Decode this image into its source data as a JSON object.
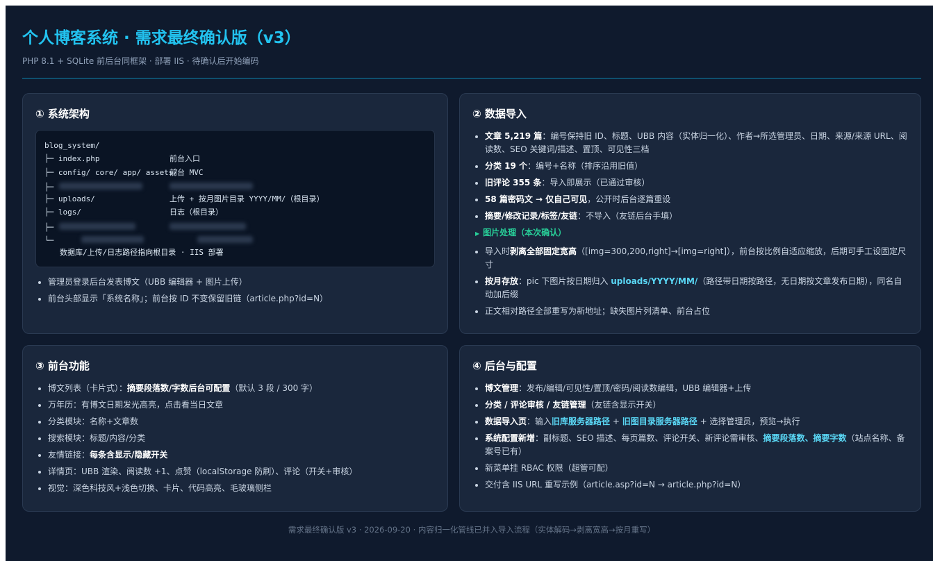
{
  "header": {
    "title": "个人博客系统 · 需求最终确认版（v3）",
    "subtitle": "PHP 8.1 + SQLite 前后台同框架 · 部署 IIS · 待确认后开始编码"
  },
  "cards": {
    "arch": {
      "title": "① 系统架构",
      "code": {
        "root": "blog_system/",
        "l1a": "├─ index.php",
        "l1b": "前台入口",
        "l2a": "├─ config/ core/ app/ assets/",
        "l2b": "前台 MVC",
        "l3a": "├─",
        "l4a": "├─ uploads/",
        "l4b": "上传 + 按月图片目录 YYYY/MM/（根目录）",
        "l5a": "├─ logs/",
        "l5b": "日志（根目录）",
        "l6a": "├─",
        "l7a": "└─",
        "note": "数据库/上传/日志路径指向根目录 · IIS 部署"
      },
      "bullets": [
        "管理员登录后台发表博文（UBB 编辑器 + 图片上传）",
        "前台头部显示「系统名称」；前台按 ID 不变保留旧链（article.php?id=N）"
      ]
    },
    "import": {
      "title": "② 数据导入",
      "b1": {
        "strong": "文章 5,219 篇",
        "text": "：编号保持旧 ID、标题、UBB 内容（实体归一化）、作者→所选管理员、日期、来源/来源 URL、阅读数、SEO 关键词/描述、置顶、可见性三档"
      },
      "b2": {
        "strong": "分类 19 个",
        "text": "：编号+名称（排序沿用旧值）"
      },
      "b3": {
        "strong": "旧评论 355 条",
        "text": "：导入即展示（已通过审核）"
      },
      "b4": {
        "strong": "58 篇密码文 → 仅自己可见",
        "text": "，公开时后台逐篇重设"
      },
      "b5": {
        "strong": "摘要/修改记录/标签/友链",
        "text": "：不导入（友链后台手填）"
      },
      "sub": "图片处理（本次确认）",
      "b6": {
        "pre": "导入时",
        "strong": "剥离全部固定宽高",
        "text": "（[img=300,200,right]→[img=right]），前台按比例自适应缩放，后期可手工设固定尺寸"
      },
      "b7": {
        "strong": "按月存放",
        "mid": "：pic 下图片按日期归入 ",
        "hl": "uploads/YYYY/MM/",
        "text": "（路径带日期按路径，无日期按文章发布日期），同名自动加后缀"
      },
      "b8": "正文相对路径全部重写为新地址；缺失图片列清单、前台占位"
    },
    "front": {
      "title": "③ 前台功能",
      "b1": {
        "pre": "博文列表（卡片式）：",
        "strong": "摘要段落数/字数后台可配置",
        "text": "（默认 3 段 / 300 字）"
      },
      "b2": "万年历：有博文日期发光高亮，点击看当日文章",
      "b3": "分类模块：名称+文章数",
      "b4": "搜索模块：标题/内容/分类",
      "b5": {
        "pre": "友情链接：",
        "strong": "每条含显示/隐藏开关"
      },
      "b6": "详情页：UBB 渲染、阅读数 +1、点赞（localStorage 防刷）、评论（开关+审核）",
      "b7": "视觉：深色科技风+浅色切换、卡片、代码高亮、毛玻璃侧栏"
    },
    "admin": {
      "title": "④ 后台与配置",
      "b1": {
        "strong": "博文管理",
        "text": "：发布/编辑/可见性/置顶/密码/阅读数编辑，UBB 编辑器+上传"
      },
      "b2": {
        "strong": "分类 / 评论审核 / 友链管理",
        "text": "（友链含显示开关）"
      },
      "b3": {
        "strong": "数据导入页",
        "pre": "：输入",
        "hl1": "旧库服务器路径",
        "mid": " + ",
        "hl2": "旧图目录服务器路径",
        "text": " + 选择管理员，预览→执行"
      },
      "b4": {
        "strong": "系统配置新增",
        "pre": "：副标题、SEO 描述、每页篇数、评论开关、新评论需审核、",
        "hl": "摘要段落数、摘要字数",
        "text": "（站点名称、备案号已有）"
      },
      "b5": "新菜单挂 RBAC 权限（超管可配）",
      "b6": "交付含 IIS URL 重写示例（article.asp?id=N → article.php?id=N）"
    }
  },
  "footer": "需求最终确认版 v3 · 2026-09-20 · 内容归一化管线已并入导入流程（实体解码→剥离宽高→按月重写）",
  "colors": {
    "accent": "#22c3f0",
    "green": "#28d19a",
    "bg": "#0f1a2d",
    "card": "#1a273c"
  }
}
